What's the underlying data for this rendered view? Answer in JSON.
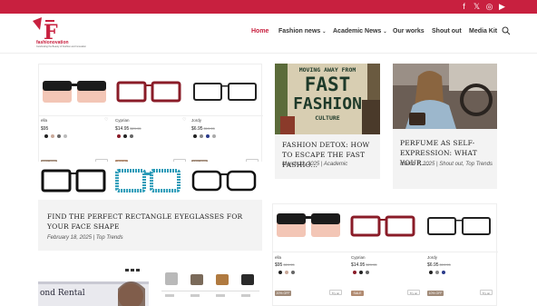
{
  "topbar": {
    "social": [
      "f",
      "𝕏",
      "◎",
      "▶"
    ]
  },
  "header": {
    "logo_text": "fashionovation",
    "logo_sub": "Celebrating the Beauty of Fashion and Innovation",
    "nav": [
      {
        "label": "Home",
        "active": true,
        "dropdown": false
      },
      {
        "label": "Fashion news",
        "active": false,
        "dropdown": true
      },
      {
        "label": "Academic News",
        "active": false,
        "dropdown": true
      },
      {
        "label": "Our works",
        "active": false,
        "dropdown": false
      },
      {
        "label": "Shout out",
        "active": false,
        "dropdown": false
      },
      {
        "label": "Media Kit",
        "active": false,
        "dropdown": false
      }
    ]
  },
  "grid_top": {
    "products": [
      {
        "name": "ella",
        "price": "$95",
        "old": ""
      },
      {
        "name": "Cyprian",
        "price": "$14.95",
        "old": "$29.95"
      },
      {
        "name": "Jordy",
        "price": "$6.95",
        "old": "$19.95"
      }
    ],
    "tags": [
      "20% OFF",
      "SALE",
      "10% OFF"
    ],
    "tryon": "Try on"
  },
  "cards": [
    {
      "image_text": [
        "MOVING AWAY FROM",
        "FAST",
        "FASHION",
        "CULTURE"
      ],
      "title": "FASHION DETOX: HOW TO ESCAPE THE FAST FASHIO...",
      "meta": "March 11, 2025 | Academic"
    },
    {
      "title": "PERFUME AS SELF-EXPRESSION: WHAT YOUR...",
      "meta": "March 7, 2025 | Shout out, Top Trends"
    },
    {
      "title": "FIND THE PERFECT RECTANGLE EYEGLASSES FOR YOUR FACE SHAPE",
      "meta": "February 18, 2025 | Top Trends"
    }
  ],
  "grid_bottom": {
    "products": [
      {
        "name": "ella",
        "price": "$95",
        "old": "$19.95"
      },
      {
        "name": "Cyprian",
        "price": "$14.95",
        "old": "$29.95"
      },
      {
        "name": "Jordy",
        "price": "$6.95",
        "old": "$19.95"
      }
    ],
    "tags": [
      "20% OFF",
      "SALE",
      "10% OFF"
    ],
    "tryon": "Try on"
  },
  "bottom_left": {
    "banner_text": "ond Rental"
  },
  "colors": {
    "brand": "#c8203f",
    "card_bg": "#f3f3f3",
    "tag_sale": "#b08a70",
    "tag_off": "#a08a78"
  }
}
